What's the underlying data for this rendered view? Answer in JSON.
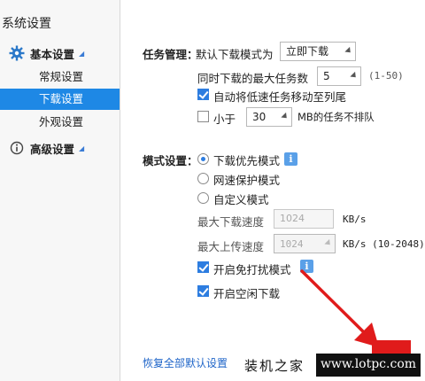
{
  "sidebar": {
    "title": "系统设置",
    "basic_section": {
      "label": "基本设置",
      "icon": "gear-icon"
    },
    "items": [
      {
        "label": "常规设置",
        "active": false
      },
      {
        "label": "下载设置",
        "active": true
      },
      {
        "label": "外观设置",
        "active": false
      }
    ],
    "advanced_section": {
      "label": "高级设置",
      "icon": "info-circle-icon"
    }
  },
  "task": {
    "heading": "任务管理：",
    "default_mode_label": "默认下载模式为",
    "default_mode_value": "立即下载",
    "max_tasks_label": "同时下载的最大任务数",
    "max_tasks_value": "5",
    "max_tasks_range": "(1-50)",
    "auto_move_label": "自动将低速任务移动至列尾",
    "auto_move_checked": true,
    "lessthan_prefix": "小于",
    "lessthan_value": "30",
    "lessthan_suffix": "MB的任务不排队",
    "lessthan_checked": false
  },
  "mode": {
    "heading": "模式设置：",
    "options": [
      {
        "label": "下载优先模式",
        "selected": true
      },
      {
        "label": "网速保护模式",
        "selected": false
      },
      {
        "label": "自定义模式",
        "selected": false
      }
    ],
    "max_download_label": "最大下载速度",
    "max_download_value": "1024",
    "max_download_unit": "KB/s",
    "max_upload_label": "最大上传速度",
    "max_upload_value": "1024",
    "max_upload_unit": "KB/s  (10-2048)",
    "no_disturb_label": "开启免打扰模式",
    "no_disturb_checked": true,
    "idle_download_label": "开启空闲下载",
    "idle_download_checked": true
  },
  "footer": {
    "restore_defaults": "恢复全部默认设置"
  },
  "watermark": {
    "cn": "装机之家",
    "url": "www.lotpc.com"
  },
  "colors": {
    "accent": "#1e88e5",
    "checkbox": "#2d7de0",
    "arrow": "#e01b1b"
  }
}
